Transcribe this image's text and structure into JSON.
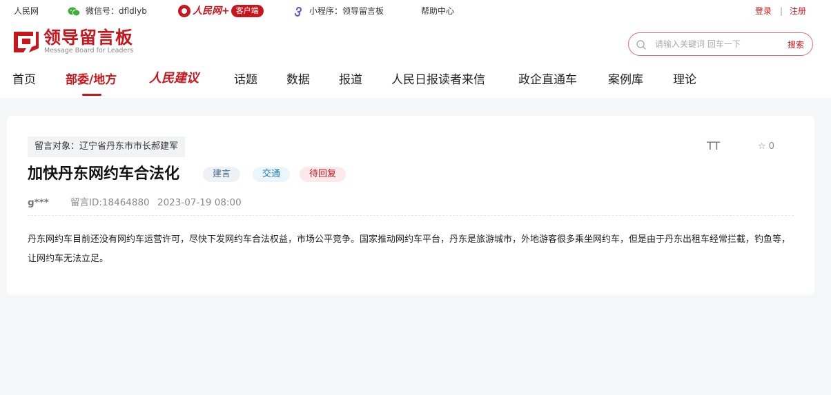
{
  "topbar": {
    "people_net": "人民网",
    "wechat_label": "微信号：dfldlyb",
    "app_name": "人民网+",
    "app_pill": "客户端",
    "miniapp_label": "小程序：领导留言板",
    "help": "帮助中心",
    "login": "登录",
    "sep": "|",
    "register": "注册"
  },
  "logo": {
    "cn": "领导留言板",
    "en": "Message Board for Leaders"
  },
  "search": {
    "placeholder": "请输入关键词 回车一下",
    "button": "搜索"
  },
  "nav": {
    "items": [
      "首页",
      "部委/地方",
      "人民建议",
      "话题",
      "数据",
      "报道",
      "人民日报读者来信",
      "政企直通车",
      "案例库",
      "理论"
    ],
    "active": "部委/地方"
  },
  "message": {
    "target": "留言对象：辽宁省丹东市市长郝建军",
    "title": "加快丹东网约车合法化",
    "tags": [
      "建言",
      "交通",
      "待回复"
    ],
    "font_toggle": "TT",
    "favorites": "☆ 0",
    "user": "g***",
    "message_id": "留言ID:18464880",
    "time": "2023-07-19 08:00",
    "body": "丹东网约车目前还没有网约车运营许可，尽快下发网约车合法权益，市场公平竞争。国家推动网约车平台，丹东是旅游城市，外地游客很多乘坐网约车，但是由于丹东出租车经常拦截，钓鱼等，让网约车无法立足。"
  },
  "colors": {
    "brand": "#c8161d",
    "page_bg": "#f5f6f8"
  },
  "icons": {
    "wechat": "wechat-icon",
    "miniapp": "miniapp-icon",
    "search": "search-icon",
    "star": "star-icon"
  }
}
